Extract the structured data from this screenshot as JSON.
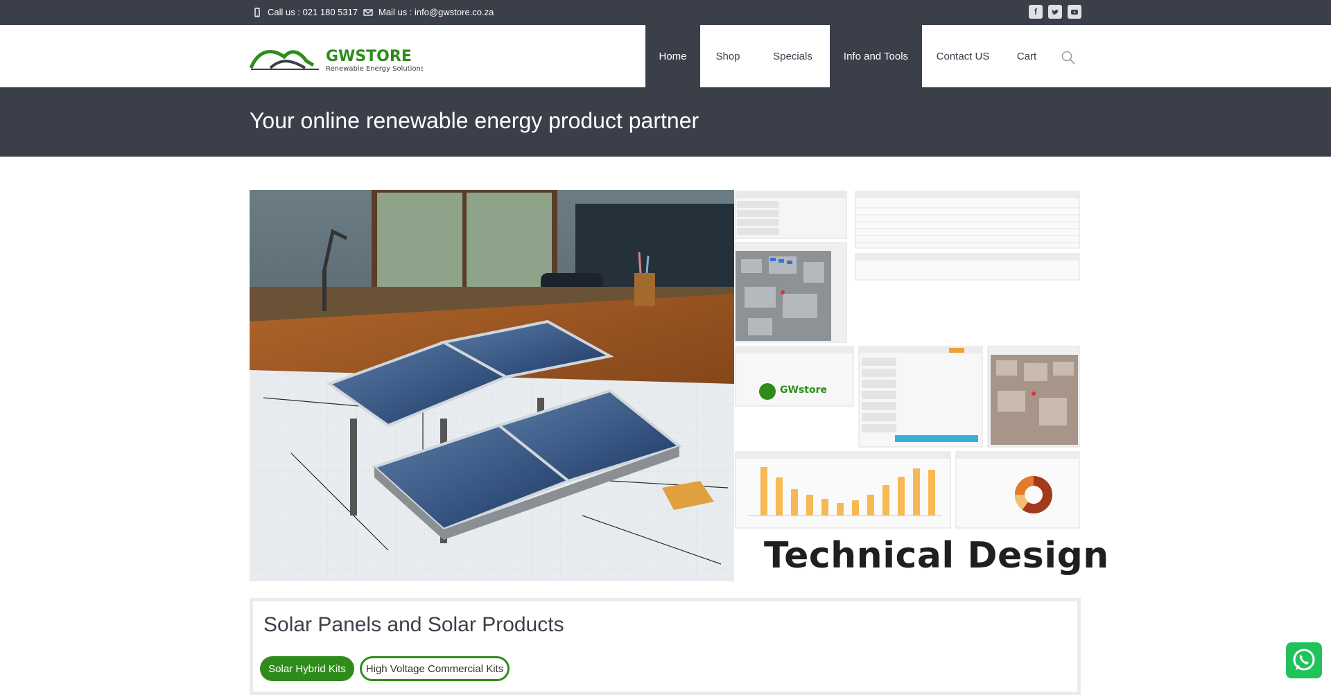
{
  "topbar": {
    "call": "Call us : 021 180 5317",
    "mail": "Mail us : info@gwstore.co.za",
    "social": [
      "facebook-icon",
      "twitter-icon",
      "youtube-icon"
    ]
  },
  "brand": {
    "name": "GWSTORE",
    "tagline": "Renewable Energy Solutions",
    "color_green": "#2f8c1c",
    "color_dark": "#3b3f4a"
  },
  "nav": {
    "items": [
      {
        "label": "Home",
        "active": true
      },
      {
        "label": "Shop",
        "active": false
      },
      {
        "label": "Specials",
        "active": false
      },
      {
        "label": "Info and Tools",
        "active": true
      },
      {
        "label": "Contact US",
        "active": false
      },
      {
        "label": "Cart",
        "active": false
      }
    ]
  },
  "hero": {
    "title": "Your online renewable energy product partner"
  },
  "banner": {
    "caption": "Technical Design",
    "dash_logo": "GWstore"
  },
  "products": {
    "title": "Solar Panels and Solar Products",
    "tabs": [
      "Solar Hybrid Kits",
      "High Voltage Commercial Kits"
    ]
  }
}
